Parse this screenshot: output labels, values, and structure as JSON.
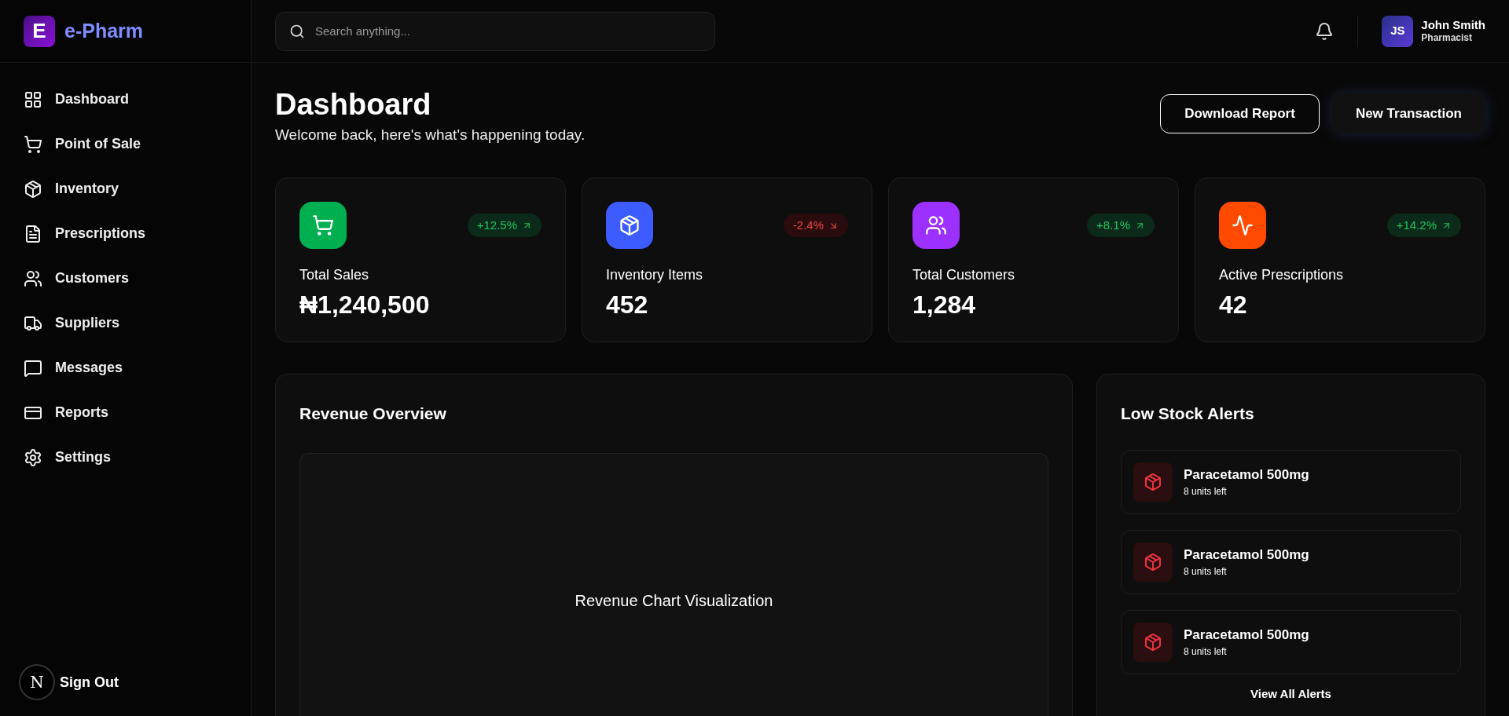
{
  "brand": {
    "logo_letter": "E",
    "name": "e-Pharm"
  },
  "sidebar": {
    "items": [
      {
        "label": "Dashboard"
      },
      {
        "label": "Point of Sale"
      },
      {
        "label": "Inventory"
      },
      {
        "label": "Prescriptions"
      },
      {
        "label": "Customers"
      },
      {
        "label": "Suppliers"
      },
      {
        "label": "Messages"
      },
      {
        "label": "Reports"
      },
      {
        "label": "Settings"
      }
    ],
    "dev_badge": "N",
    "sign_out": "Sign Out"
  },
  "header": {
    "search": {
      "placeholder": "Search anything..."
    },
    "user": {
      "initials": "JS",
      "name": "John Smith",
      "role": "Pharmacist"
    }
  },
  "page": {
    "title": "Dashboard",
    "subtitle": "Welcome back, here's what's happening today.",
    "buttons": [
      {
        "kind": "outline",
        "label": "Download Report"
      },
      {
        "kind": "solid",
        "label": "New Transaction"
      }
    ]
  },
  "stats": [
    {
      "color": "#00b050",
      "kind": "up",
      "change": "+12.5%",
      "label": "Total Sales",
      "value": "₦1,240,500"
    },
    {
      "color": "#3d5cff",
      "kind": "down",
      "change": "-2.4%",
      "label": "Inventory Items",
      "value": "452"
    },
    {
      "color": "#9b30ff",
      "kind": "up",
      "change": "+8.1%",
      "label": "Total Customers",
      "value": "1,284"
    },
    {
      "color": "#ff4a00",
      "kind": "up",
      "change": "+14.2%",
      "label": "Active Prescriptions",
      "value": "42"
    }
  ],
  "revenue": {
    "title": "Revenue Overview",
    "placeholder": "Revenue Chart Visualization"
  },
  "alerts": {
    "title": "Low Stock Alerts",
    "items": [
      {
        "name": "Paracetamol 500mg",
        "detail": "8 units left"
      },
      {
        "name": "Paracetamol 500mg",
        "detail": "8 units left"
      },
      {
        "name": "Paracetamol 500mg",
        "detail": "8 units left"
      }
    ],
    "link": "View All Alerts"
  }
}
